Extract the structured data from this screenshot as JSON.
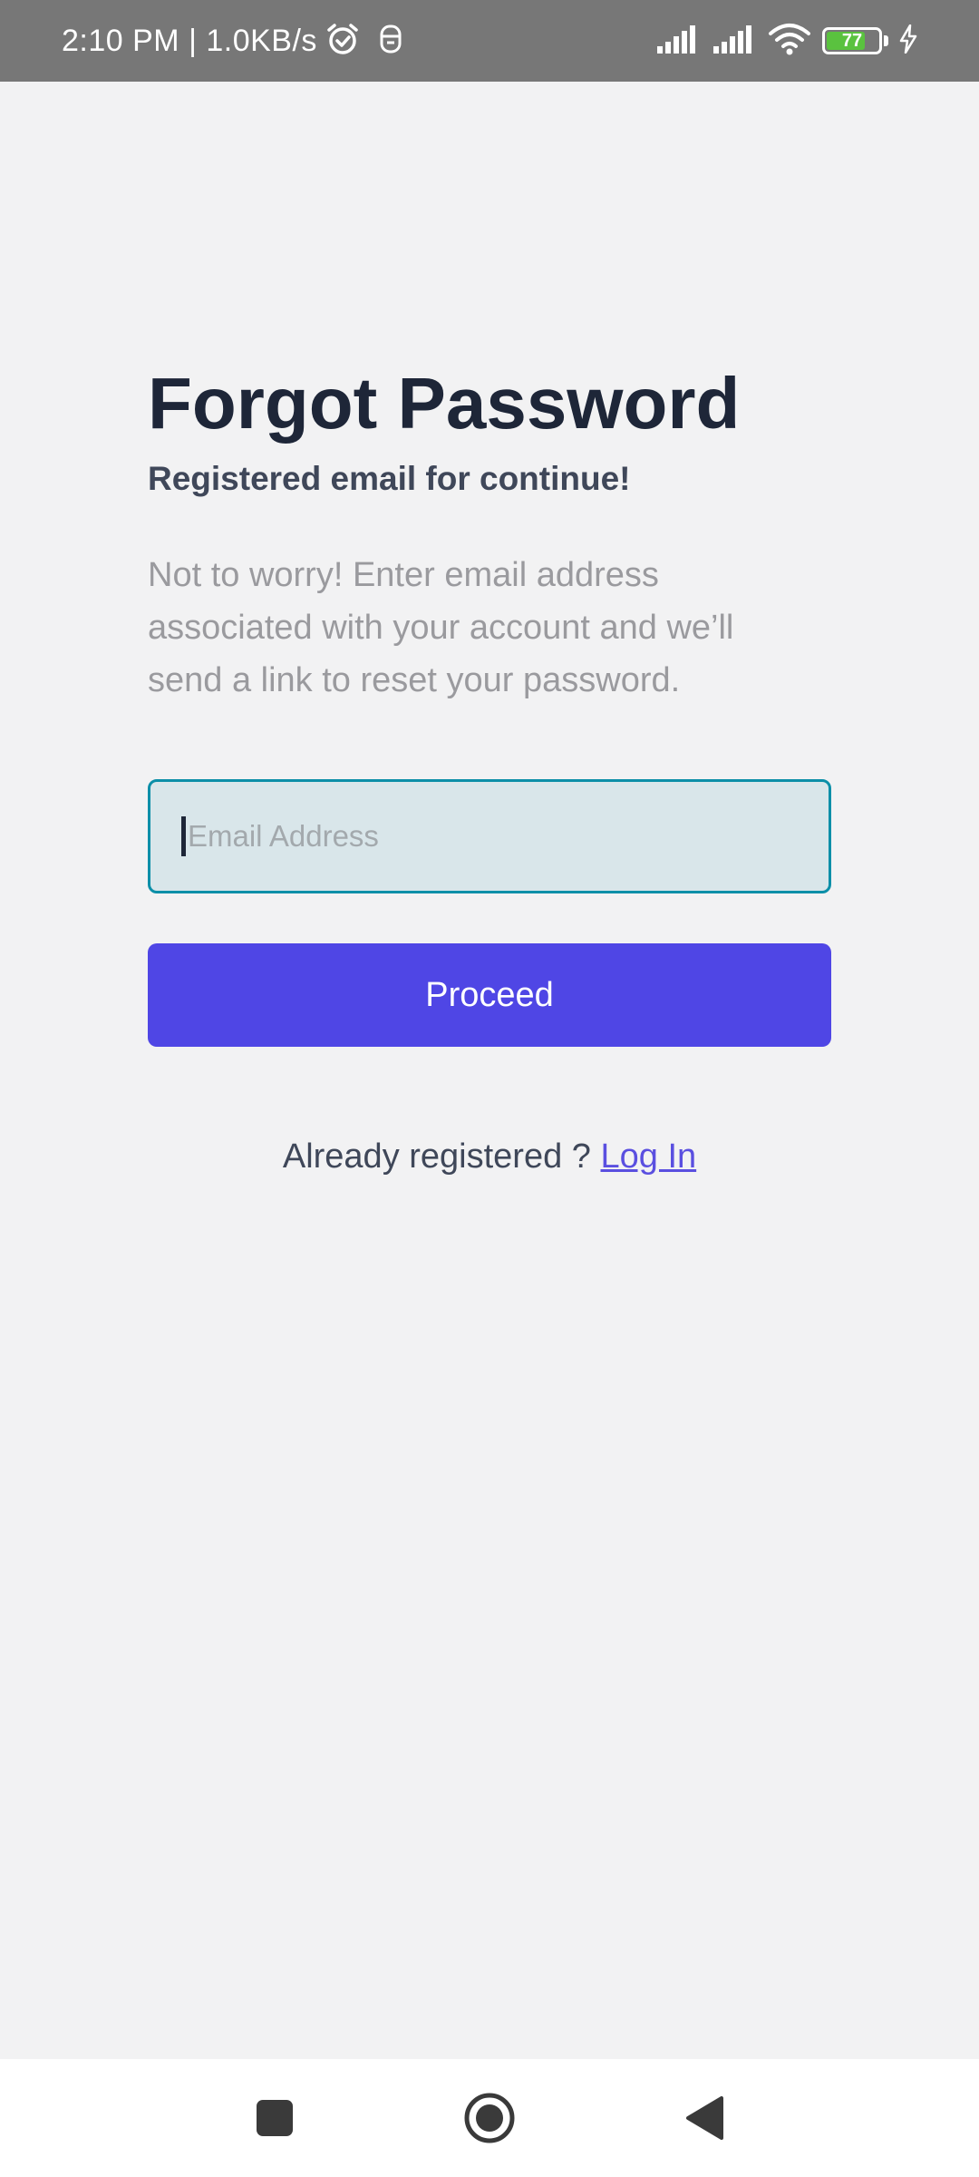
{
  "status_bar": {
    "time_speed": "2:10 PM | 1.0KB/s",
    "battery_level": "77",
    "battery_fraction": 0.77,
    "icons": [
      "alarm-icon",
      "notification-icon",
      "signal-icon",
      "signal-icon",
      "wifi-icon",
      "battery-icon",
      "charging-icon"
    ]
  },
  "main": {
    "title": "Forgot Password",
    "subtitle": "Registered email for continue!",
    "description": "Not to worry! Enter email address associated with your account and we’ll send a link to reset your password.",
    "email_placeholder": "Email Address",
    "email_value": "",
    "proceed_label": "Proceed",
    "login_prompt": "Already registered ? ",
    "login_link": "Log In"
  },
  "nav_bar": {
    "buttons": [
      "recent-apps",
      "home",
      "back"
    ]
  },
  "colors": {
    "background": "#f2f2f3",
    "status_bar": "#777777",
    "title": "#1e2638",
    "accent": "#4f46e5",
    "link": "#5a4fe0",
    "field_bg": "#d9e6ea",
    "field_border": "#0c8fa8",
    "battery_fill": "#5ac23f"
  }
}
